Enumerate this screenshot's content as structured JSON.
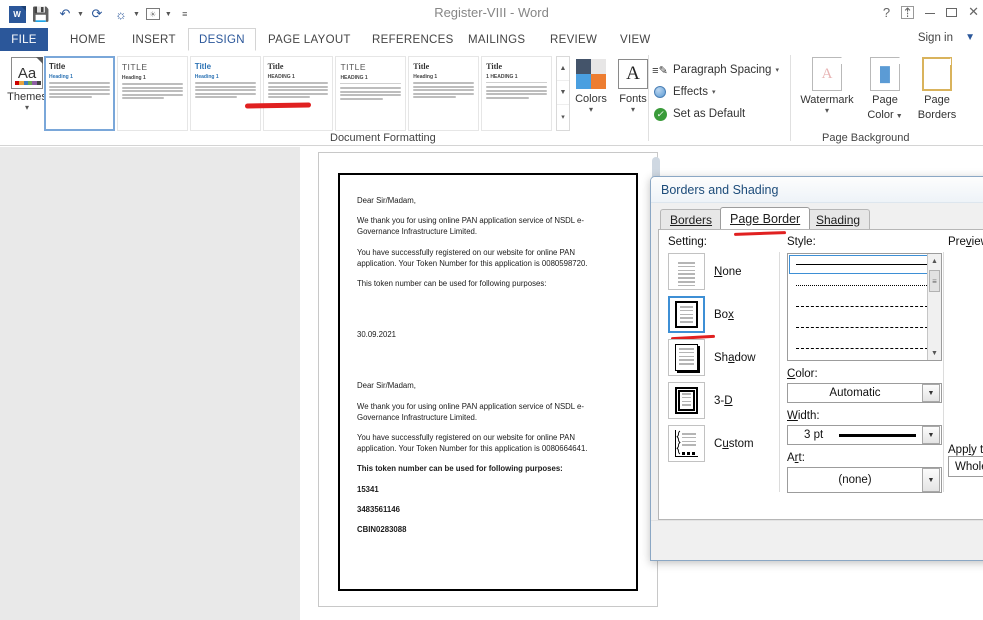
{
  "window": {
    "title": "Register-VIII - Word",
    "quick_access": [
      {
        "name": "word-logo",
        "label": "W"
      },
      {
        "name": "save-icon",
        "label": "ὋE"
      },
      {
        "name": "undo-icon",
        "label": "↶"
      },
      {
        "name": "redo-icon",
        "label": "↻"
      },
      {
        "name": "touch-mode-icon",
        "label": "☀"
      },
      {
        "name": "picture-icon",
        "label": "ὛC"
      },
      {
        "name": "customize-qat-icon",
        "label": "☰"
      }
    ],
    "controls": {
      "help": "?",
      "ribbon_display": "⤒",
      "minimize": "—",
      "maximize": "□",
      "close": "✕"
    },
    "sign_in": "Sign in"
  },
  "ribbon_tabs": [
    {
      "label": "FILE",
      "active": false
    },
    {
      "label": "HOME",
      "active": false
    },
    {
      "label": "INSERT",
      "active": false
    },
    {
      "label": "DESIGN",
      "active": true
    },
    {
      "label": "PAGE LAYOUT",
      "active": false
    },
    {
      "label": "REFERENCES",
      "active": false
    },
    {
      "label": "MAILINGS",
      "active": false
    },
    {
      "label": "REVIEW",
      "active": false
    },
    {
      "label": "VIEW",
      "active": false
    }
  ],
  "ribbon": {
    "themes": {
      "label": "Themes",
      "caret": "▾"
    },
    "gallery_group_label": "Document Formatting",
    "gallery": [
      {
        "title": "Title",
        "heading": "Heading 1",
        "selected": true,
        "style": "blue"
      },
      {
        "title": "TITLE",
        "heading": "Heading 1",
        "selected": false,
        "style": "caps"
      },
      {
        "title": "Title",
        "heading": "Heading 1",
        "selected": false,
        "style": "blue"
      },
      {
        "title": "Title",
        "heading": "HEADING 1",
        "selected": false,
        "style": "serif"
      },
      {
        "title": "TITLE",
        "heading": "HEADING 1",
        "selected": false,
        "style": "caps"
      },
      {
        "title": "Title",
        "heading": "Heading 1",
        "selected": false,
        "style": "serif"
      },
      {
        "title": "Title",
        "heading": "1  HEADING 1",
        "selected": false,
        "style": "plain"
      }
    ],
    "colors": {
      "label": "Colors",
      "caret": "▾",
      "swatches": [
        "#44546a",
        "#e7e6e6",
        "#4a9fe0",
        "#ed7d31"
      ]
    },
    "fonts": {
      "label": "Fonts",
      "caret": "▾",
      "glyph": "A"
    },
    "paragraph_spacing": {
      "label": "Paragraph Spacing",
      "caret": "▾"
    },
    "effects": {
      "label": "Effects",
      "caret": "▾"
    },
    "set_as_default": {
      "label": "Set as Default"
    },
    "watermark": {
      "label": "Watermark",
      "caret": "▾",
      "glyph": "A"
    },
    "page_color": {
      "label_top": "Page",
      "label_bottom": "Color",
      "caret": "▾"
    },
    "page_borders": {
      "label_top": "Page",
      "label_bottom": "Borders"
    },
    "page_background_group_label": "Page Background"
  },
  "document": {
    "paragraphs": [
      {
        "text": "Dear Sir/Madam,",
        "bold": false
      },
      {
        "text": "We thank you for using online PAN application service of NSDL e-Governance Infrastructure Limited.",
        "bold": false
      },
      {
        "text": "You have successfully registered on our website for online PAN application. Your Token Number for this application is 0080598720.",
        "bold": false
      },
      {
        "text": "This token number can be used for following purposes:",
        "bold": false
      },
      {
        "text": "",
        "bold": false
      },
      {
        "text": "30.09.2021",
        "bold": false
      },
      {
        "text": "",
        "bold": false
      },
      {
        "text": "Dear Sir/Madam,",
        "bold": false
      },
      {
        "text": "We thank you for using online PAN application service of NSDL e-Governance Infrastructure Limited.",
        "bold": false
      },
      {
        "text": "You have successfully registered on our website for online PAN application. Your Token Number for this application is 0080664641.",
        "bold": false
      },
      {
        "text": "This token number can be used for following purposes:",
        "bold": true
      },
      {
        "text": "15341",
        "bold": true
      },
      {
        "text": "3483561146",
        "bold": true
      },
      {
        "text": "CBIN0283088",
        "bold": true
      }
    ]
  },
  "dialog": {
    "title": "Borders and Shading",
    "tabs": [
      {
        "label": "Borders",
        "active": false
      },
      {
        "label": "Page Border",
        "active": true
      },
      {
        "label": "Shading",
        "active": false
      }
    ],
    "setting": {
      "label": "Setting:",
      "options": [
        {
          "label": "None",
          "selected": false
        },
        {
          "label": "Box",
          "selected": true
        },
        {
          "label": "Shadow",
          "selected": false
        },
        {
          "label": "3-D",
          "selected": false
        },
        {
          "label": "Custom",
          "selected": false
        }
      ]
    },
    "style": {
      "label": "Style:",
      "options": [
        {
          "kind": "solid",
          "selected": true
        },
        {
          "kind": "dotted",
          "selected": false
        },
        {
          "kind": "dashed-sm",
          "selected": false
        },
        {
          "kind": "dashed-md",
          "selected": false
        },
        {
          "kind": "dash-dot",
          "selected": false
        }
      ]
    },
    "color": {
      "label": "Color:",
      "value": "Automatic"
    },
    "width": {
      "label": "Width:",
      "value": "3 pt"
    },
    "art": {
      "label": "Art:",
      "value": "(none)"
    },
    "preview": {
      "label": "Preview"
    },
    "apply_to": {
      "label": "Apply to",
      "value": "Whole d"
    }
  },
  "annotations": {
    "color": "#e02020",
    "marks": [
      "page-background-underline",
      "page-border-tab-underline",
      "box-setting-underline",
      "gallery-top-mark"
    ]
  }
}
